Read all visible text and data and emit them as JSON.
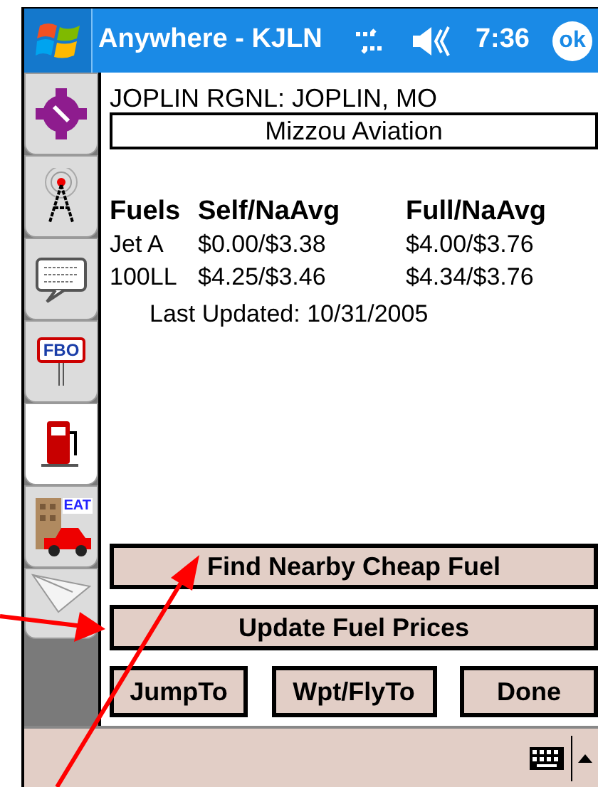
{
  "title_bar": {
    "title": "Anywhere - KJLN",
    "time": "7:36",
    "ok": "ok"
  },
  "sidebar": {
    "tabs": [
      {
        "kind": "waypoint",
        "selected": false
      },
      {
        "kind": "radio",
        "selected": false
      },
      {
        "kind": "message",
        "selected": false
      },
      {
        "kind": "fbo",
        "label": "FBO",
        "selected": false
      },
      {
        "kind": "fuel",
        "selected": true
      },
      {
        "kind": "food",
        "label": "EAT",
        "selected": false
      },
      {
        "kind": "plane",
        "selected": false
      }
    ]
  },
  "airport": "JOPLIN RGNL: JOPLIN, MO",
  "fbo_field": {
    "value": "Mizzou Aviation"
  },
  "fuel_table": {
    "columns": [
      "Fuels",
      "Self/NaAvg",
      "Full/NaAvg"
    ],
    "rows": [
      [
        "Jet A",
        "$0.00/$3.38",
        "$4.00/$3.76"
      ],
      [
        "100LL",
        "$4.25/$3.46",
        "$4.34/$3.76"
      ]
    ]
  },
  "last_updated": "Last Updated: 10/31/2005",
  "wide_buttons": [
    "Find Nearby Cheap Fuel",
    "Update Fuel Prices"
  ],
  "buttons": [
    "JumpTo",
    "Wpt/FlyTo",
    "Done"
  ]
}
